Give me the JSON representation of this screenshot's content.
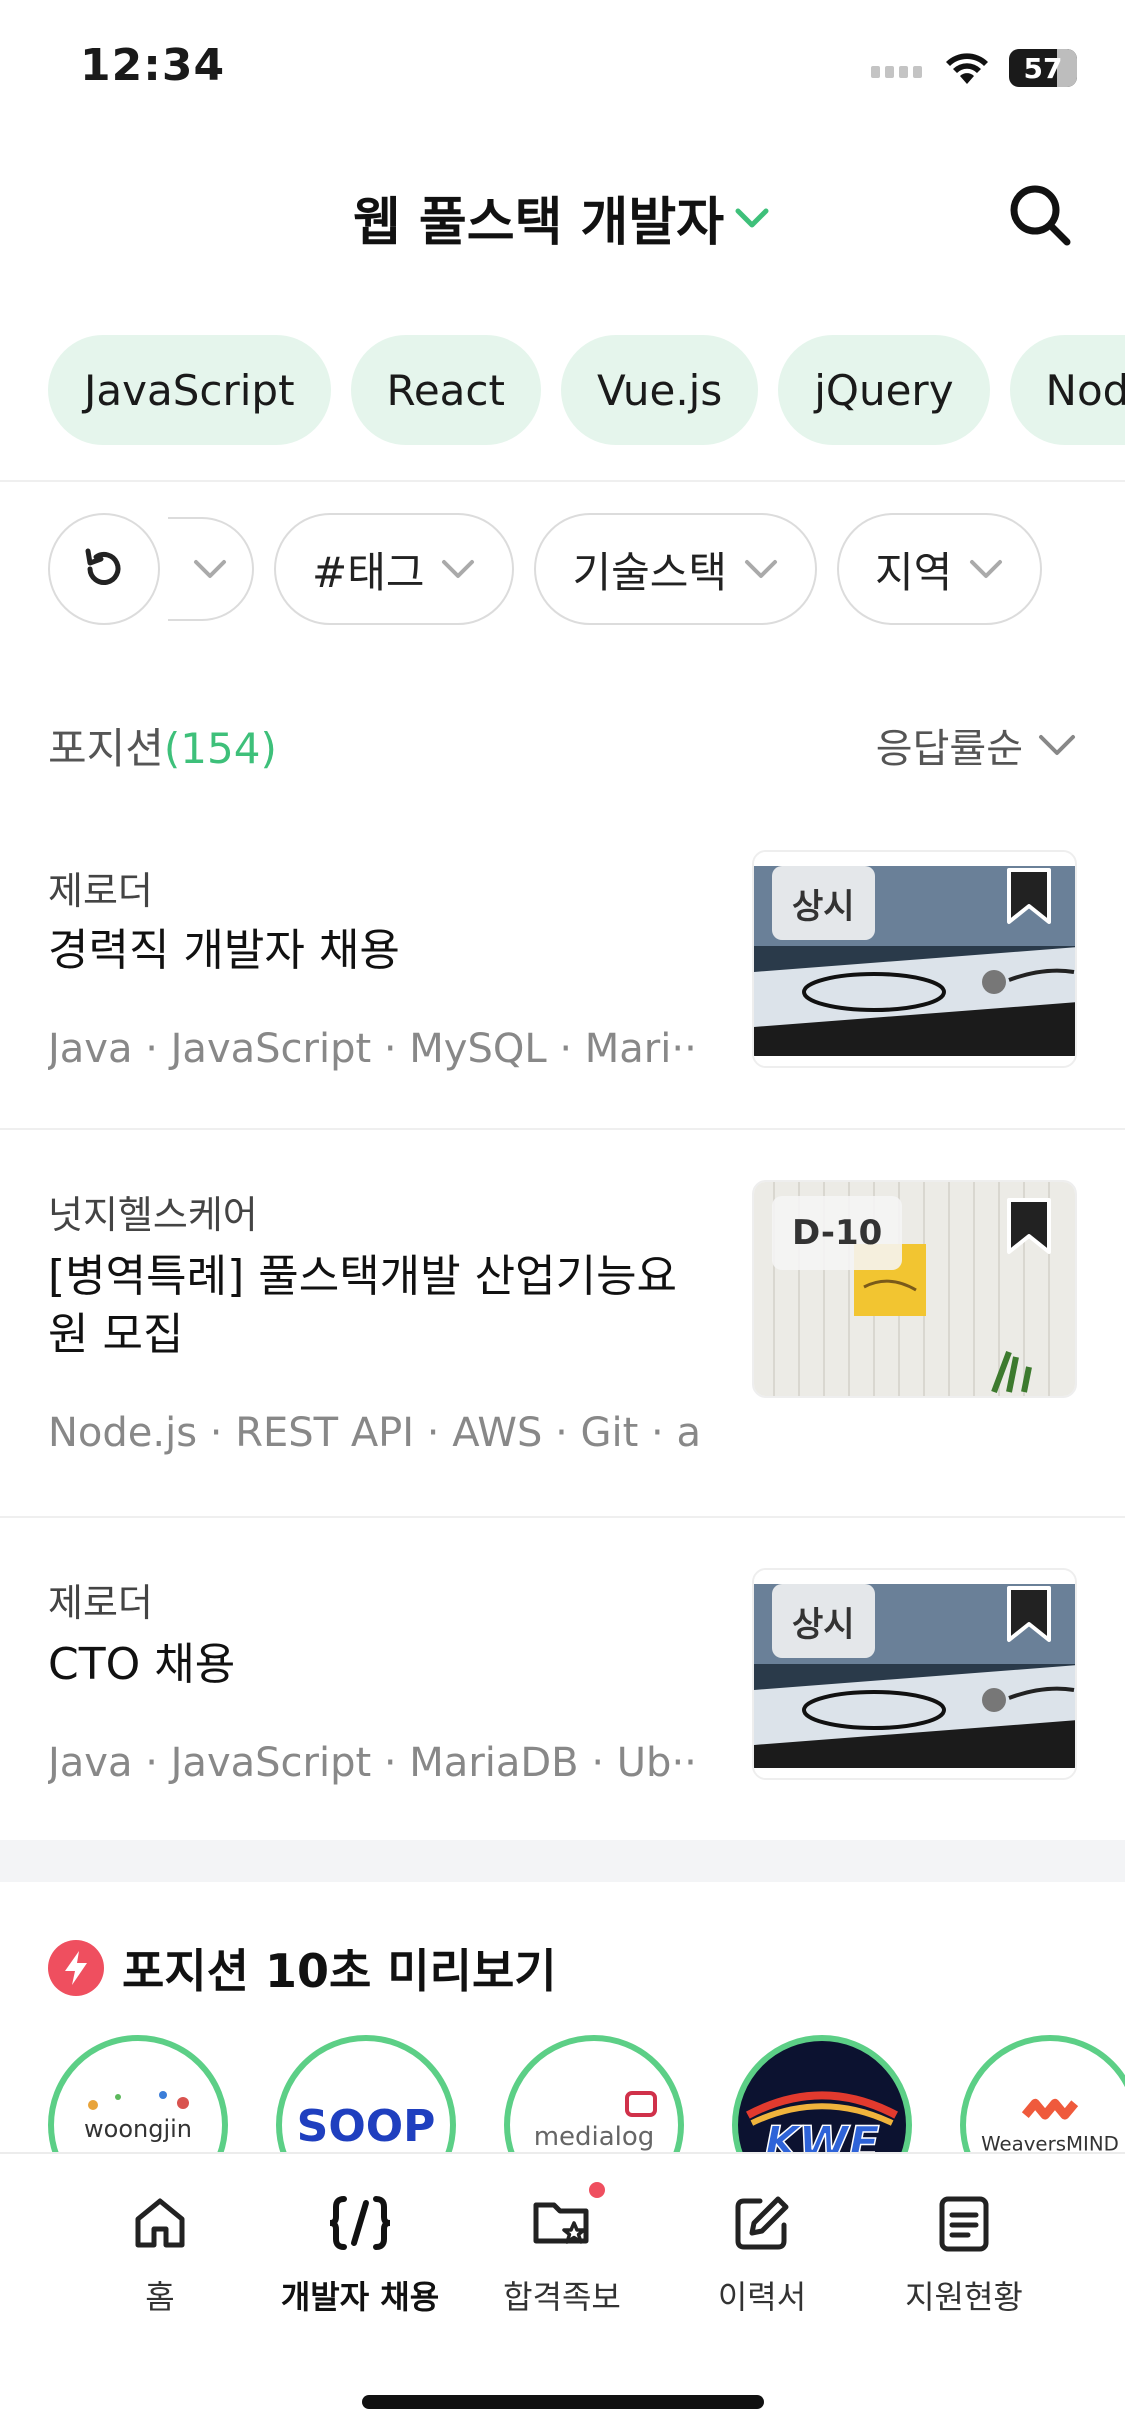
{
  "status_bar": {
    "time": "12:34",
    "battery": "57"
  },
  "header": {
    "title": "웹 풀스택 개발자"
  },
  "tech_chips": [
    "JavaScript",
    "React",
    "Vue.js",
    "jQuery",
    "Node.js"
  ],
  "filters": [
    "#태그",
    "기술스택",
    "지역"
  ],
  "list": {
    "label": "포지션",
    "count": "(154)",
    "sort_label": "응답률순"
  },
  "jobs": [
    {
      "company": "제로더",
      "title": "경력직 개발자 채용",
      "tags": "Java · JavaScript · MySQL · Mari···",
      "badge": "상시"
    },
    {
      "company": "넛지헬스케어",
      "title": "[병역특례] 풀스택개발 산업기능요원 모집",
      "tags": "Node.js · REST API · AWS · Git · a···",
      "badge": "D-10"
    },
    {
      "company": "제로더",
      "title": "CTO 채용",
      "tags": "Java · JavaScript · MariaDB · Ub···",
      "badge": "상시"
    }
  ],
  "preview": {
    "title": "포지션 10초 미리보기",
    "logos": [
      "woongjin",
      "SOOP",
      "medialog",
      "KWE",
      "WeaversMIND"
    ]
  },
  "nav": [
    "홈",
    "개발자 채용",
    "합격족보",
    "이력서",
    "지원현황"
  ],
  "colors": {
    "accent_green": "#3ec07a",
    "chip_bg": "#e5f5ec",
    "alert_red": "#ef4f5f"
  }
}
